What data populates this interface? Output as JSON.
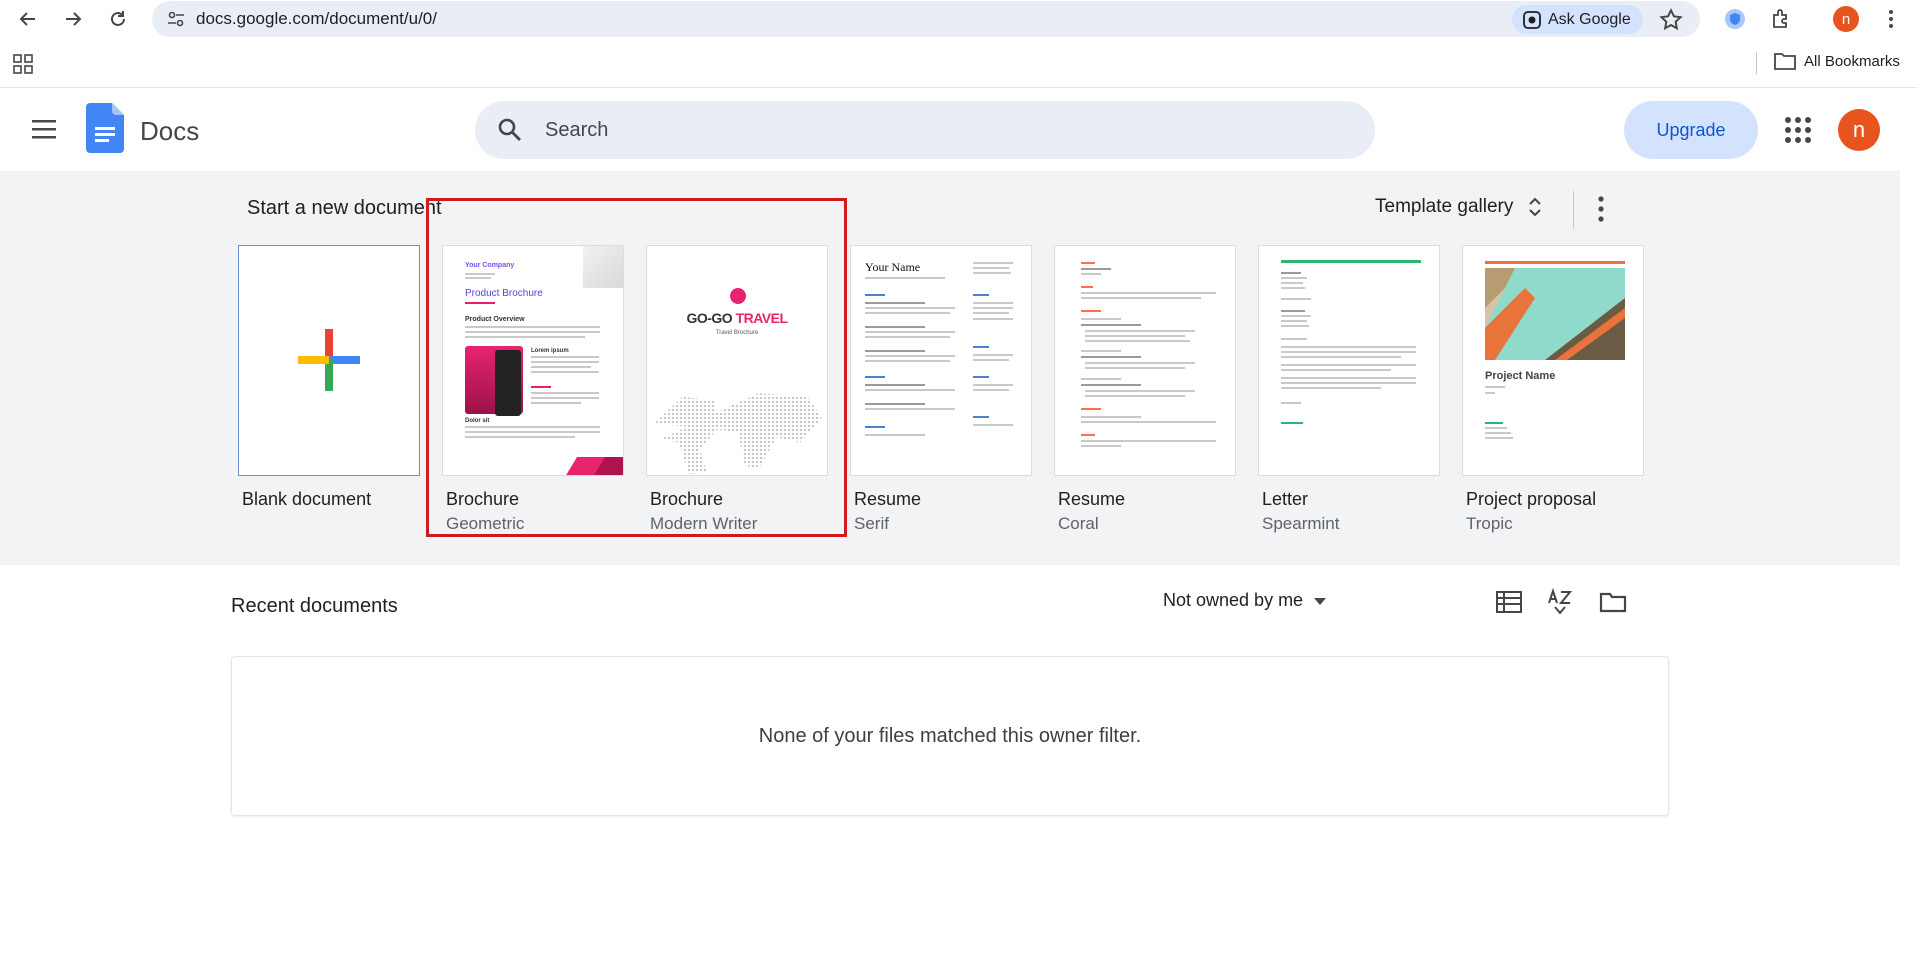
{
  "browser": {
    "url": "docs.google.com/document/u/0/",
    "ask_google_label": "Ask Google",
    "profile_initial": "n",
    "all_bookmarks_label": "All Bookmarks"
  },
  "header": {
    "app_title": "Docs",
    "search_placeholder": "Search",
    "upgrade_label": "Upgrade",
    "profile_initial": "n"
  },
  "templates": {
    "section_title": "Start a new document",
    "gallery_label": "Template gallery",
    "items": [
      {
        "title": "Blank document",
        "subtitle": ""
      },
      {
        "title": "Brochure",
        "subtitle": "Geometric"
      },
      {
        "title": "Brochure",
        "subtitle": "Modern Writer"
      },
      {
        "title": "Resume",
        "subtitle": "Serif"
      },
      {
        "title": "Resume",
        "subtitle": "Coral"
      },
      {
        "title": "Letter",
        "subtitle": "Spearmint"
      },
      {
        "title": "Project proposal",
        "subtitle": "Tropic"
      }
    ],
    "thumbs": {
      "geometric_company": "Your Company",
      "geometric_heading": "Product Brochure",
      "geometric_overview": "Product Overview",
      "geometric_lorem": "Lorem ipsum",
      "geometric_dolor": "Dolor sit",
      "travel_brand_1": "GO-GO",
      "travel_brand_2": "TRAVEL",
      "travel_sub": "Travel Brochure",
      "resume_name": "Your Name",
      "proposal_name": "Project Name"
    }
  },
  "recent": {
    "title": "Recent documents",
    "owner_filter_label": "Not owned by me",
    "empty_message": "None of your files matched this owner filter."
  },
  "colors": {
    "accent_blue": "#0b57d0",
    "upgrade_bg": "#d3e3fd",
    "profile_orange": "#e8541e",
    "highlight_red": "#d11a1a"
  }
}
